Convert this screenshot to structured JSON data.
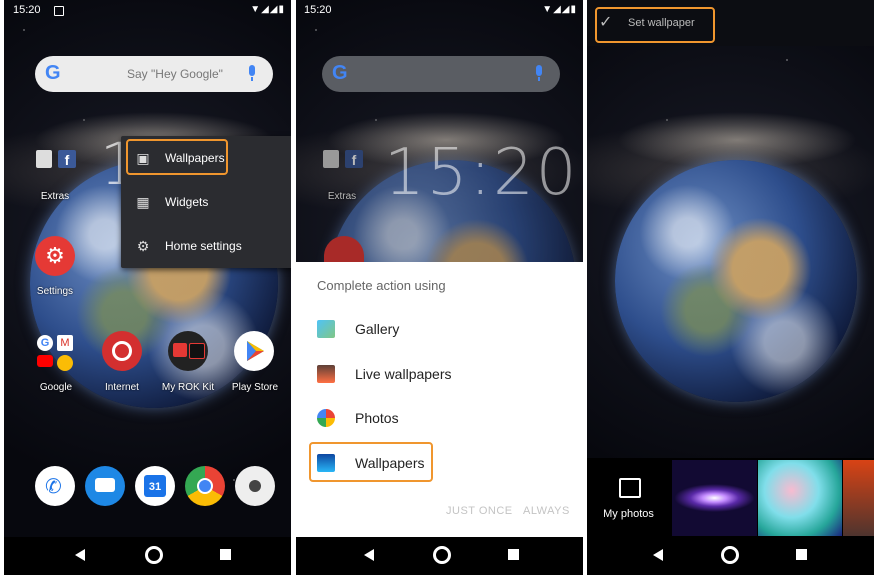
{
  "panel1": {
    "status_time": "15:20",
    "search_placeholder": "Say \"Hey Google\"",
    "menu": [
      {
        "label": "Wallpapers",
        "icon": "wallpaper-icon"
      },
      {
        "label": "Widgets",
        "icon": "widgets-icon"
      },
      {
        "label": "Home settings",
        "icon": "gear-icon"
      }
    ],
    "apps": {
      "extras": "Extras",
      "settings": "Settings",
      "google": "Google",
      "internet": "Internet",
      "myrok": "My ROK Kit",
      "playstore": "Play Store"
    },
    "dock_calendar_number": "31",
    "clock_partial": "1"
  },
  "panel2": {
    "status_time": "15:20",
    "clock": "15:20",
    "extras": "Extras",
    "sheet_title": "Complete action using",
    "options": [
      "Gallery",
      "Live wallpapers",
      "Photos",
      "Wallpapers"
    ],
    "just_once": "JUST ONCE",
    "always": "ALWAYS"
  },
  "panel3": {
    "set_wallpaper": "Set wallpaper",
    "my_photos": "My photos"
  },
  "colors": {
    "highlight": "#f0962e",
    "menu_bg": "#2b2c30"
  }
}
